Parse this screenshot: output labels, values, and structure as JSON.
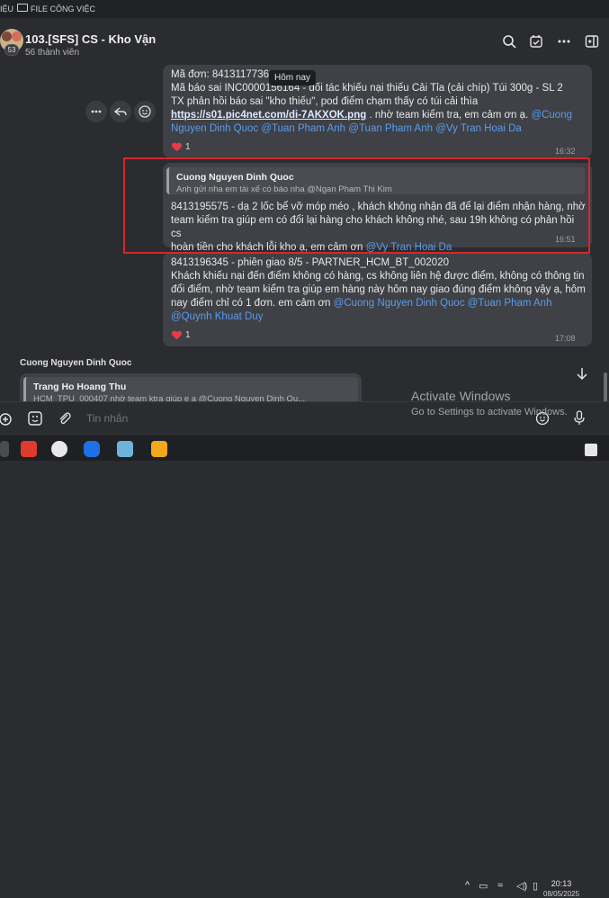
{
  "top_strip": {
    "left_text": "IỆU",
    "folder_label": "FILE CÔNG VIỆC"
  },
  "group": {
    "name": "103.[SFS] CS - Kho Vận",
    "members": "56 thành viên",
    "avatar_badge": "53"
  },
  "tooltip": "Hôm nay",
  "messages": [
    {
      "lines": [
        "Mã đơn: 8413117736",
        "Mã báo sai INC0000156164 - đối tác khiếu nại thiếu Cải Tỉa (cải chíp) Túi 300g - SL 2",
        "TX phản hồi báo sai \"kho thiếu\", pod điểm chạm thấy có túi cải thìa"
      ],
      "link": "https://s01.pic4net.com/di-7AKXOK.png",
      "line4_rest": " . nhờ team kiểm tra, em cảm ơn ạ.",
      "mention_1": "@Cuong",
      "line5": "Nguyen Dinh Quoc @Tuan Pham Anh @Tuan Pham Anh @Vy Tran Hoai Da",
      "reaction_count": "1",
      "time": "16:32"
    },
    {
      "quote_name": "Cuong Nguyen Dinh Quoc",
      "quote_text": "Anh gửi nha em tài xế có báo nha @Ngan Pham Thi Kim",
      "lines": [
        "8413195575  - dạ 2 lốc bể vỡ móp méo , khách không nhận đã để lại điểm nhận hàng, nhờ",
        "team kiểm tra giúp em có đổi lại hàng cho khách không nhé, sau 19h không có phản hồi cs",
        "hoàn tiền cho khách lỗi kho ạ, em cảm ơn "
      ],
      "mention": "@Vy Tran Hoai Da",
      "time": "16:51"
    },
    {
      "lines": [
        "8413196345 - phiên giao 8/5 - PARTNER_HCM_BT_002020",
        "Khách khiếu nại đến điểm không có hàng, cs không liên hệ được điểm, không có thông tin",
        "đổi điểm, nhờ team kiểm tra giúp em hàng này hôm nay giao đúng điểm không vậy ạ, hôm",
        "nay điểm chỉ có 1 đơn. em cảm ơn "
      ],
      "mention_line4": "@Cuong Nguyen Dinh Quoc @Tuan Pham Anh",
      "mention_line5": "@Quynh Khuat Duy",
      "reaction_count": "1",
      "time": "17:08"
    }
  ],
  "next_sender": "Cuong Nguyen Dinh Quoc",
  "next_quote": {
    "name": "Trang Ho Hoang Thu",
    "text": "HCM_TPU_000407 nhờ team ktra giúp e ạ @Cuong Nguyen Dinh Qu..."
  },
  "composer": {
    "placeholder": "Tin nhắn"
  },
  "watermark": {
    "title": "Activate Windows",
    "subtitle": "Go to Settings to activate Windows."
  },
  "clock": {
    "time": "20:13",
    "date": "08/05/2025"
  }
}
